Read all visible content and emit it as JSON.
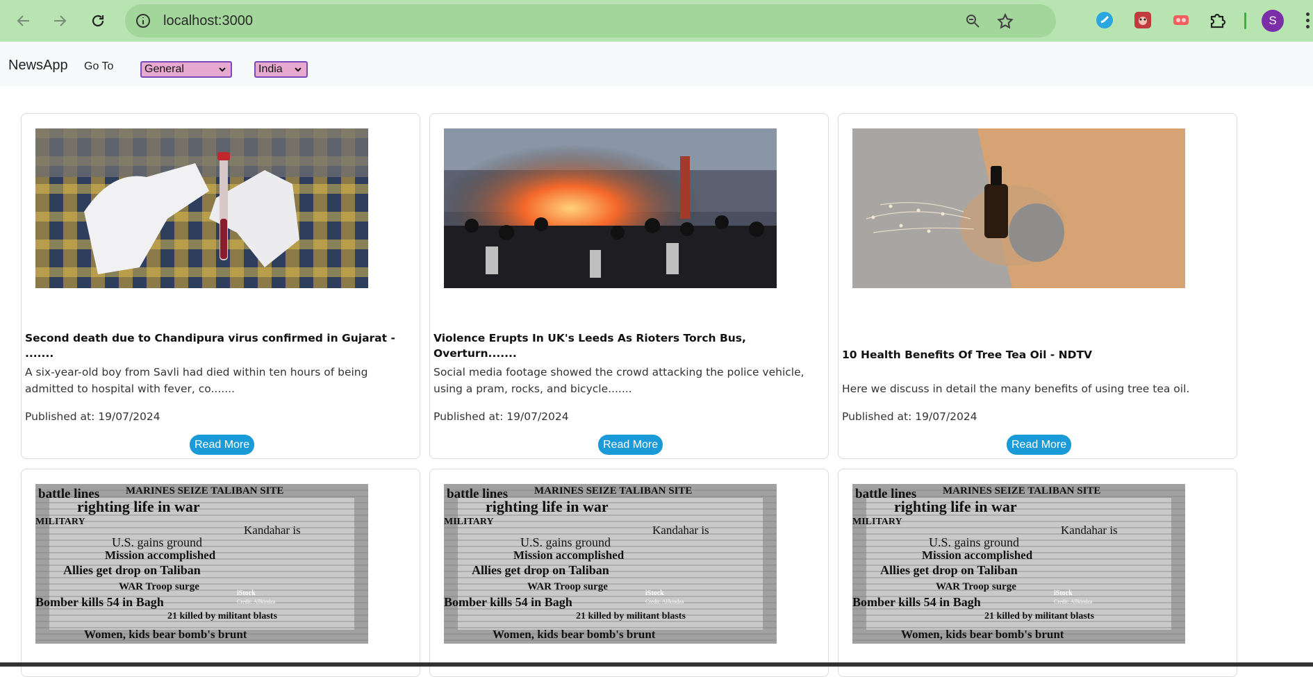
{
  "browser": {
    "url": "localhost:3000",
    "avatar_letter": "S",
    "extensions": [
      "sync-icon",
      "bug-icon",
      "vr-headset-icon",
      "puzzle-icon"
    ]
  },
  "navbar": {
    "brand": "NewsApp",
    "goto_label": "Go To",
    "category_selected": "General",
    "country_selected": "India"
  },
  "articles": [
    {
      "title": "Second death due to Chandipura virus confirmed in Gujarat - .......",
      "description": "A six-year-old boy from Savli had died within ten hours of being admitted to hospital with fever, co.......",
      "published": "Published at: 19/07/2024",
      "read_more": "Read More"
    },
    {
      "title": "Violence Erupts In UK's Leeds As Rioters Torch Bus, Overturn.......",
      "description": "Social media footage showed the crowd attacking the police vehicle, using a pram, rocks, and bicycle.......",
      "published": "Published at: 19/07/2024",
      "read_more": "Read More"
    },
    {
      "title": "10 Health Benefits Of Tree Tea Oil - NDTV",
      "description": "Here we discuss in detail the many benefits of using tree tea oil.",
      "published": "Published at: 19/07/2024",
      "read_more": "Read More"
    }
  ],
  "newspaper_collage": {
    "headlines": [
      "battle lines",
      "MARINES SEIZE TALIBAN SITE",
      "righting life in war",
      "MILITARY",
      "Kandahar is",
      "U.S. gains ground",
      "Mission accomplished",
      "Allies get drop on Taliban",
      "WAR Troop surge",
      "Bomber kills 54 in Bagh",
      "21 killed by militant blasts",
      "Women, kids bear bomb's brunt",
      "iStock",
      "Credit: Allkindza"
    ]
  },
  "colors": {
    "chrome_bg": "#b7e4b0",
    "omnibox_bg": "#a3d69b",
    "select_bg": "#e7a9d0",
    "select_border": "#7a4ab8",
    "read_more_bg": "#1a9ad6",
    "avatar_bg": "#7b2ea8"
  }
}
